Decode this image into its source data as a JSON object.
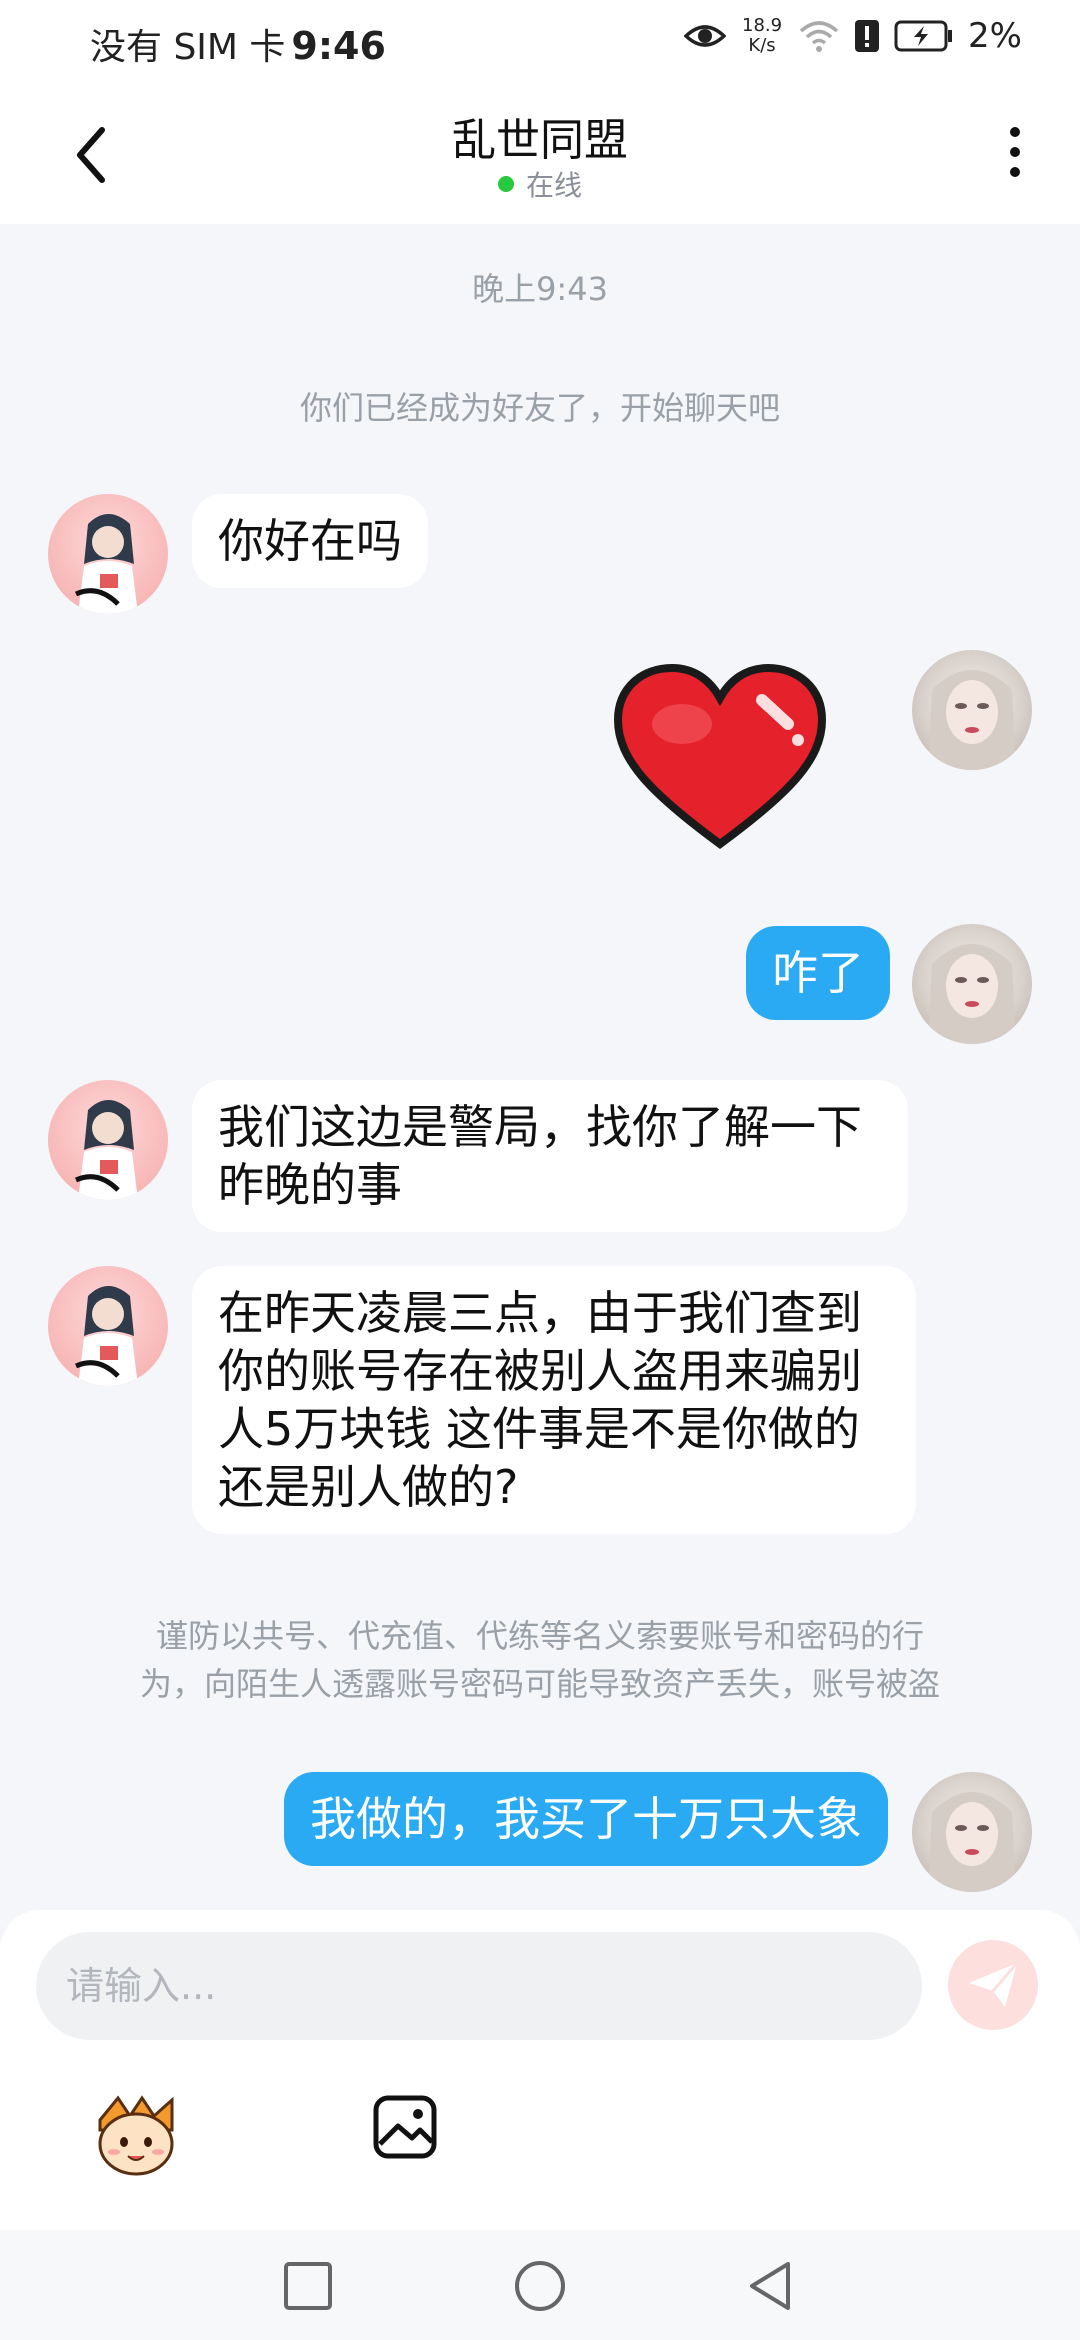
{
  "status_bar": {
    "carrier": "没有 SIM 卡",
    "time": "9:46",
    "net_speed_value": "18.9",
    "net_speed_unit": "K/s",
    "battery": "2%"
  },
  "header": {
    "title": "乱世同盟",
    "status": "在线"
  },
  "chat": {
    "time_tag": "晚上9:43",
    "system_friend": "你们已经成为好友了，开始聊天吧",
    "messages": [
      {
        "from": "other",
        "text": "你好在吗"
      },
      {
        "from": "me",
        "sticker": "heart"
      },
      {
        "from": "me",
        "text": "咋了"
      },
      {
        "from": "other",
        "line1": "我们这边是警局，找你了解一下",
        "line2": "昨晚的事"
      },
      {
        "from": "other",
        "line1": "在昨天凌晨三点，由于我们查到",
        "line2": "你的账号存在被别人盗用来骗别",
        "line3": "人5万块钱 这件事是不是你做的",
        "line4": "还是别人做的?"
      },
      {
        "from": "me",
        "text": "我做的，我买了十万只大象"
      }
    ],
    "warning_line1": "谨防以共号、代充值、代练等名义索要账号和密码的行",
    "warning_line2": "为，向陌生人透露账号密码可能导致资产丢失，账号被盗"
  },
  "input": {
    "placeholder": "请输入..."
  },
  "colors": {
    "outgoing_bubble": "#29aaf2",
    "incoming_bubble": "#ffffff",
    "online_dot": "#27c93f",
    "send_button": "#fde0dd"
  },
  "icons": [
    "back-arrow-icon",
    "more-vertical-icon",
    "heart-sticker",
    "send-plane-icon",
    "emoji-mascot-icon",
    "image-icon",
    "nav-square-icon",
    "nav-circle-icon",
    "nav-back-triangle-icon",
    "eye-icon",
    "wifi-icon",
    "alert-icon",
    "battery-icon"
  ]
}
